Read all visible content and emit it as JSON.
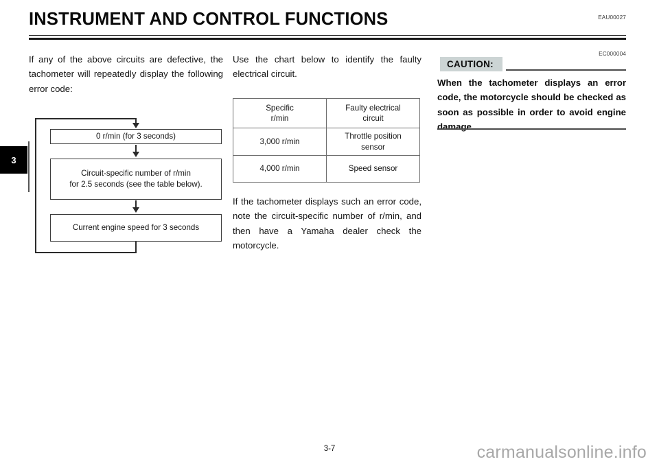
{
  "header": {
    "title": "INSTRUMENT AND CONTROL FUNCTIONS",
    "reference_code": "EAU00027"
  },
  "chapter_tab": {
    "number": "3"
  },
  "columns": {
    "left": {
      "paragraph": "If any of the above circuits are defective, the tachometer will repeatedly display the following error code:"
    },
    "middle": {
      "paragraph_1": "Use the chart below to identify the faulty electrical circuit.",
      "paragraph_2": "If the tachometer displays such an error code, note the circuit-specific number of r/min, and then have a Yamaha dealer check the motorcycle."
    }
  },
  "flowchart": {
    "steps": [
      {
        "label": "0 r/min (for 3 seconds)"
      },
      {
        "line1": "Circuit-specific number of r/min",
        "line2": "for 2.5 seconds (see the table below)."
      },
      {
        "label": "Current engine speed for 3 seconds"
      }
    ]
  },
  "fault_table": {
    "headers": {
      "col1_line1": "Specific",
      "col1_line2": "r/min",
      "col2_line1": "Faulty electrical",
      "col2_line2": "circuit"
    },
    "rows": [
      {
        "rpm": "3,000 r/min",
        "circuit_line1": "Throttle position",
        "circuit_line2": "sensor"
      },
      {
        "rpm": "4,000 r/min",
        "circuit_line1": "Speed sensor",
        "circuit_line2": ""
      }
    ]
  },
  "caution": {
    "reference_code": "EC000004",
    "label": "CAUTION:",
    "text": "When the tachometer displays an error code, the motorcycle should be checked as soon as possible in order to avoid engine damage.",
    "badge_color": "#ccd4d4"
  },
  "footer": {
    "page_number": "3-7",
    "watermark": "carmanualsonline.info"
  }
}
